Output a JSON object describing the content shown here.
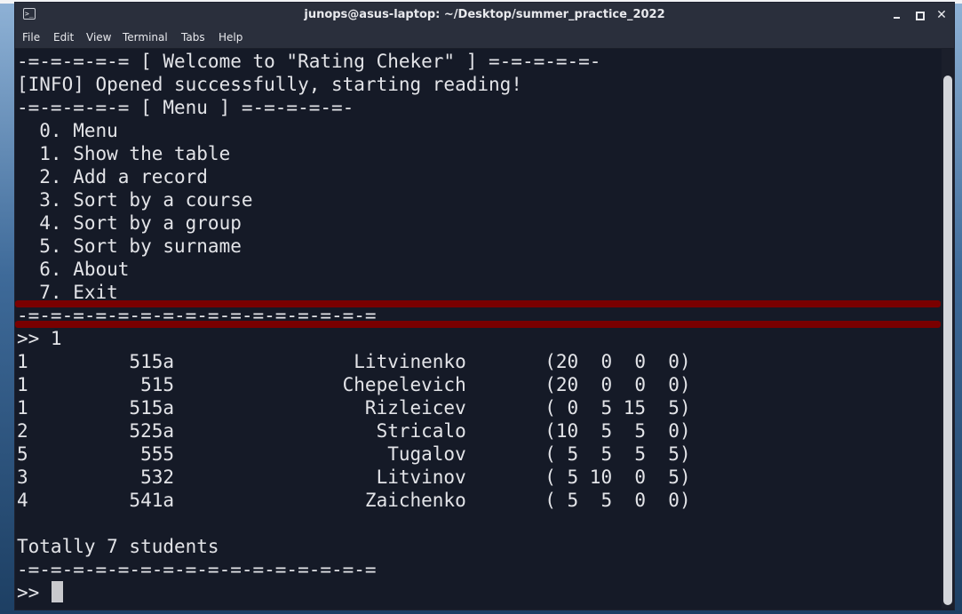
{
  "window": {
    "title": "junops@asus-laptop: ~/Desktop/summer_practice_2022",
    "close_glyph": "✕",
    "terminal_icon_glyph": ">_"
  },
  "menu": [
    "File",
    "Edit",
    "View",
    "Terminal",
    "Tabs",
    "Help"
  ],
  "terminal_lines": [
    "-=-=-=-=-= [ Welcome to \"Rating Cheker\" ] =-=-=-=-=-",
    "[INFO] Opened successfully, starting reading!",
    "-=-=-=-=-= [ Menu ] =-=-=-=-=-",
    "  0. Menu",
    "  1. Show the table",
    "  2. Add a record",
    "  3. Sort by a course",
    "  4. Sort by a group",
    "  5. Sort by surname",
    "  6. About",
    "  7. Exit",
    "-=-=-=-=-=-=-=-=-=-=-=-=-=-=-=-=",
    ">> 1",
    "1         515a                Litvinenko       (20  0  0  0)",
    "1          515               Chepelevich       (20  0  0  0)",
    "1         515a                 Rizleicev       ( 0  5 15  5)",
    "2         525a                  Stricalo       (10  5  5  0)",
    "5          555                   Tugalov       ( 5  5  5  5)",
    "3          532                  Litvinov       ( 5 10  0  5)",
    "4         541a                 Zaichenko       ( 5  5  0  0)",
    "",
    "Totally 7 students",
    "-=-=-=-=-=-=-=-=-=-=-=-=-=-=-=-=",
    ">> "
  ]
}
